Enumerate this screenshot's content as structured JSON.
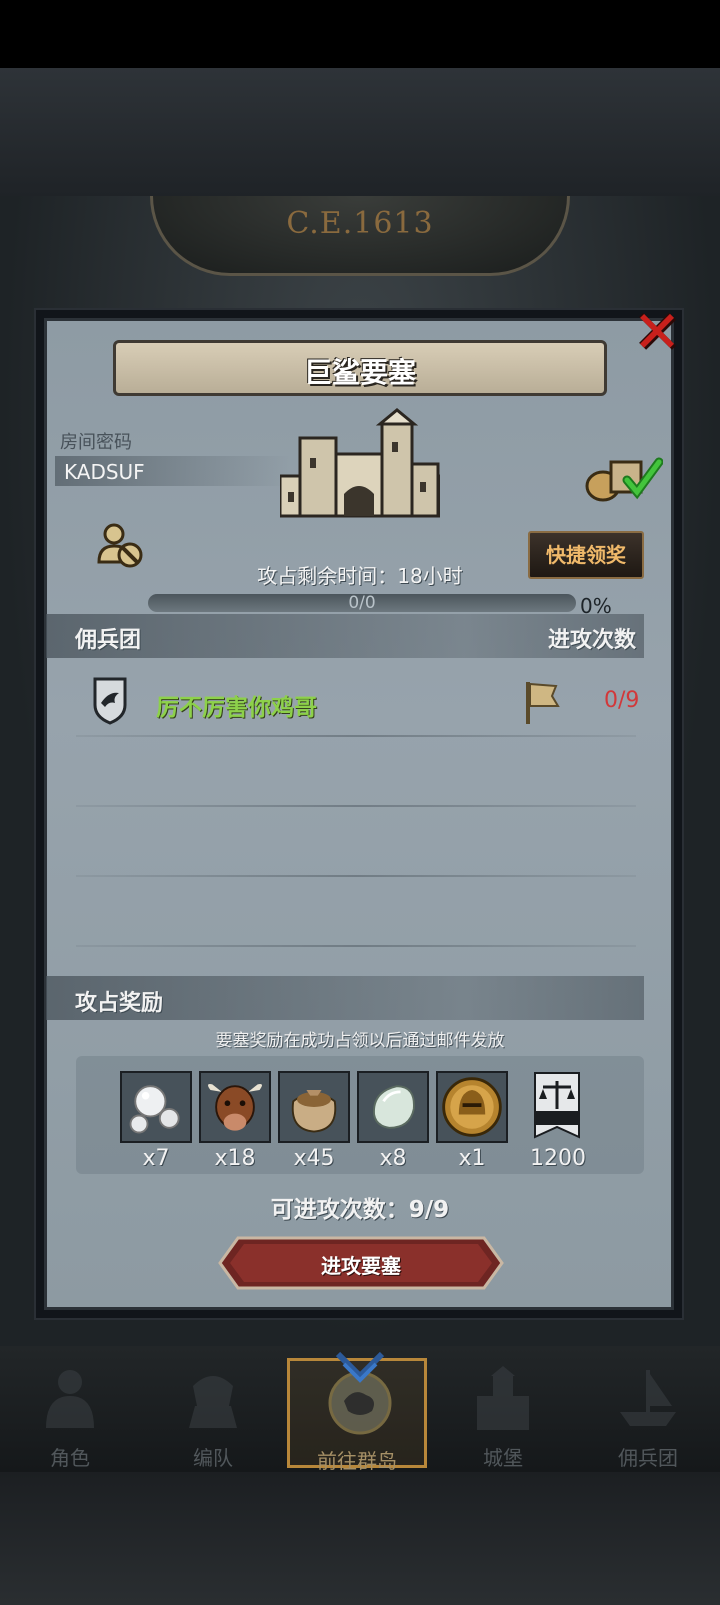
{
  "era_banner": "C.E.1613",
  "dialog": {
    "title": "巨鲨要塞",
    "room_password_label": "房间密码",
    "room_password": "KADSUF",
    "quick_claim_label": "快捷领奖",
    "time_left": "攻占剩余时间：18小时",
    "progress": {
      "fraction": 0,
      "label": "0/0",
      "percent_text": "0%"
    },
    "mercenary_header": "佣兵团",
    "attack_count_header": "进攻次数",
    "guilds": [
      {
        "name": "厉不厉害你鸡哥",
        "attacks": "0/9"
      }
    ],
    "rewards_header": "攻占奖励",
    "rewards_note": "要塞奖励在成功占领以后通过邮件发放",
    "rewards": [
      {
        "icon": "pearl-icon",
        "qty": "x7"
      },
      {
        "icon": "cattle-icon",
        "qty": "x18"
      },
      {
        "icon": "grain-sack-icon",
        "qty": "x45"
      },
      {
        "icon": "gemstone-icon",
        "qty": "x8"
      },
      {
        "icon": "knight-helmet-coin-icon",
        "qty": "x1"
      },
      {
        "icon": "scales-banner-icon",
        "qty": "1200"
      }
    ],
    "attacks_available": "可进攻次数：9/9",
    "attack_button_label": "进攻要塞"
  },
  "bottom_nav": [
    {
      "label": "角色",
      "icon": "knight-icon",
      "active": false
    },
    {
      "label": "编队",
      "icon": "formation-icon",
      "active": false
    },
    {
      "label": "前往群岛",
      "icon": "islands-icon",
      "active": true
    },
    {
      "label": "城堡",
      "icon": "castle-icon",
      "active": false
    },
    {
      "label": "佣兵团",
      "icon": "mercenary-ship-icon",
      "active": false
    }
  ],
  "colors": {
    "guild_name": "#8dd14a",
    "attacks_count": "#d2383a",
    "quick_claim_text": "#f0b96a",
    "close_x": "#c8201c",
    "attack_button": "#7a2a26"
  }
}
